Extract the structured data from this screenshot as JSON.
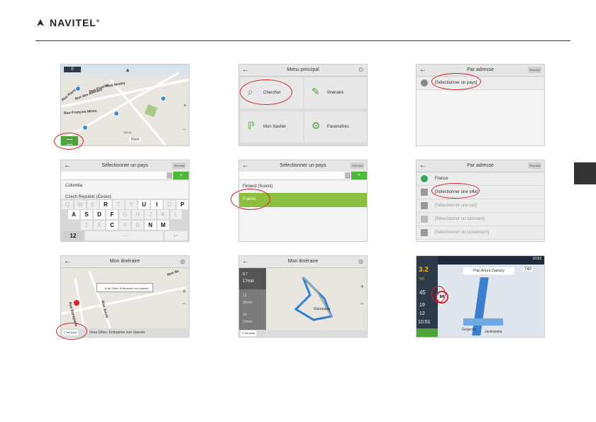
{
  "brand": {
    "name": "NAVITEL",
    "mark": "®"
  },
  "row1": {
    "map": {
      "speed": "0",
      "streets": [
        "Rue Nesley",
        "Rue Esterlin",
        "Rue des Amiraux",
        "Rue François Miron",
        "Rue Flamand",
        "Rue Saint-Paul"
      ],
      "scale": "100 m",
      "north": "Nord"
    },
    "menu": {
      "title": "Menu principal",
      "items": [
        "Chercher",
        "Itinéraire",
        "Mon Navitel",
        "Paramètres"
      ]
    },
    "address1": {
      "title": "Par adresse",
      "action": "Résultat",
      "row": "[Sélectionner un pays]"
    }
  },
  "row2": {
    "country1": {
      "title": "Sélectionner un pays",
      "action": "Résultat",
      "rows": [
        "Colomba",
        "Czech Republic (Česko)"
      ],
      "keys_row1": [
        "Q",
        "W",
        "E",
        "R",
        "T",
        "Y",
        "U",
        "I",
        "O",
        "P"
      ],
      "keys_row2": [
        "A",
        "S",
        "D",
        "F",
        "G",
        "H",
        "J",
        "K",
        "L"
      ],
      "keys_row3": [
        "Z",
        "X",
        "C",
        "V",
        "B",
        "N",
        "M"
      ],
      "numkey": "12"
    },
    "country2": {
      "title": "Sélectionner un pays",
      "action": "Résultat",
      "rows": [
        "Finland (Suomi)",
        "France"
      ]
    },
    "address2": {
      "title": "Par adresse",
      "action": "Résultat",
      "rows": [
        "France",
        "[Sélectionner une ville]",
        "[Sélectionner une rue]",
        "[Sélectionner un bâtiment]",
        "[Sélectionner un croisement]"
      ]
    }
  },
  "row3": {
    "itin1": {
      "title": "Mon itinéraire",
      "popup": "Gras Gilles, Entreprise non classée",
      "start": "C'est parti",
      "dest": "Gras Gilles, Entreprise non classée",
      "streets": [
        "Rue du",
        "Rue Bonaparte",
        "Rue Jacob"
      ]
    },
    "itin2": {
      "title": "Mon itinéraire",
      "start": "C'est parti",
      "dist1": "9.7",
      "time1": "17min",
      "dist2": "12",
      "time2": "35min",
      "dist3": "14",
      "time3": "22min",
      "city": "Warszawa"
    },
    "drive": {
      "time": "10:53",
      "street": "Plac Artura Zawiszy",
      "speed": "740",
      "speedlimit": "60",
      "dist": "3.2",
      "d2": "700",
      "v1": "45",
      "v2": "19",
      "v3": "12",
      "clock": "10:51",
      "poi": "Grojecka",
      "poi2": "Jackowska"
    }
  }
}
